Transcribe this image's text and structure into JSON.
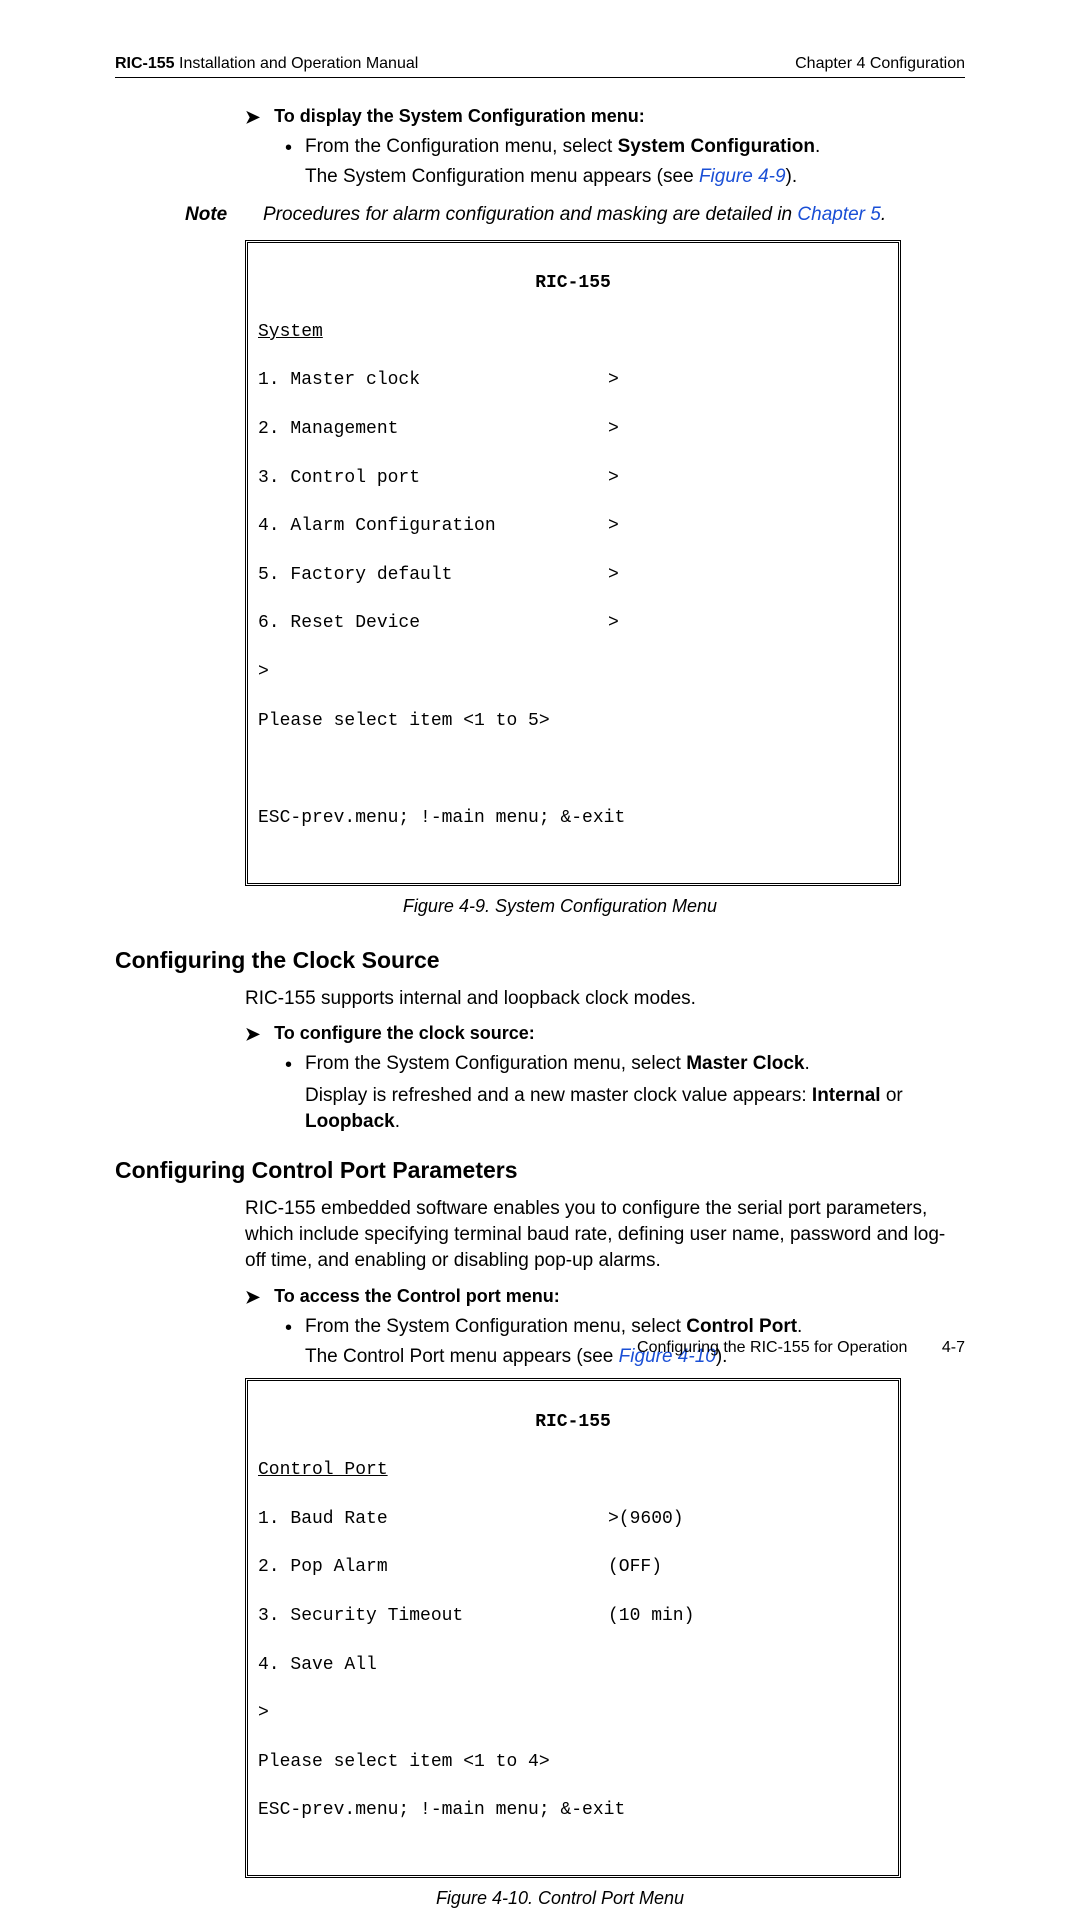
{
  "header": {
    "left_bold": "RIC-155",
    "left_rest": " Installation and Operation Manual",
    "right": "Chapter 4 Configuration"
  },
  "proc1": {
    "title": "To display the System Configuration menu:",
    "bullet_pre": "From the Configuration menu, select ",
    "bullet_bold": "System Configuration",
    "bullet_post": ".",
    "sub_pre": "The System Configuration menu appears (see ",
    "sub_link": "Figure 4-9",
    "sub_post": ")."
  },
  "note": {
    "label": "Note",
    "body_pre": "Procedures for alarm configuration and masking are detailed in ",
    "body_link": "Chapter 5",
    "body_post": "."
  },
  "term1": {
    "title": "RIC-155",
    "heading": "System",
    "items": [
      {
        "label": "1. Master clock",
        "val": ">"
      },
      {
        "label": "2. Management",
        "val": ">"
      },
      {
        "label": "3. Control port",
        "val": ">"
      },
      {
        "label": "4. Alarm Configuration",
        "val": ">"
      },
      {
        "label": "5. Factory default",
        "val": ">"
      },
      {
        "label": "6. Reset Device",
        "val": ">"
      }
    ],
    "prompt": ">",
    "please": "Please select item <1 to 5>",
    "footer": "ESC-prev.menu; !-main menu; &-exit"
  },
  "fig1_caption": "Figure 4-9.  System Configuration Menu",
  "sec1": {
    "heading": "Configuring the Clock Source",
    "para": "RIC-155 supports internal and loopback clock modes.",
    "proc_title": "To configure the clock source:",
    "bullet_pre": "From the System Configuration menu, select ",
    "bullet_bold": "Master Clock",
    "bullet_post": ".",
    "sub_pre": "Display is refreshed and a new master clock value appears: ",
    "sub_bold1": "Internal",
    "sub_mid": " or ",
    "sub_bold2": "Loopback",
    "sub_post": "."
  },
  "sec2": {
    "heading": "Configuring Control Port Parameters",
    "para": "RIC-155 embedded software enables you to configure the serial port parameters, which include specifying terminal baud rate, defining user name, password and log-off time, and enabling or disabling pop-up alarms.",
    "proc_title": "To access the Control port menu:",
    "bullet_pre": "From the System Configuration menu, select ",
    "bullet_bold": "Control Port",
    "bullet_post": ".",
    "sub_pre": "The Control Port menu appears (see ",
    "sub_link": "Figure 4-10",
    "sub_post": ")."
  },
  "term2": {
    "title": "RIC-155",
    "heading": "Control Port",
    "items": [
      {
        "label": "1. Baud Rate",
        "val": ">(9600)"
      },
      {
        "label": "2. Pop Alarm",
        "val": "(OFF)"
      },
      {
        "label": "3. Security Timeout",
        "val": "(10 min)"
      },
      {
        "label": "4. Save All",
        "val": ""
      }
    ],
    "prompt": ">",
    "please": "Please select item <1 to 4>",
    "footer": "ESC-prev.menu; !-main menu; &-exit"
  },
  "fig2_caption": "Figure 4-10.  Control Port Menu",
  "footer": {
    "text": "Configuring the RIC-155 for Operation",
    "page": "4-7"
  }
}
